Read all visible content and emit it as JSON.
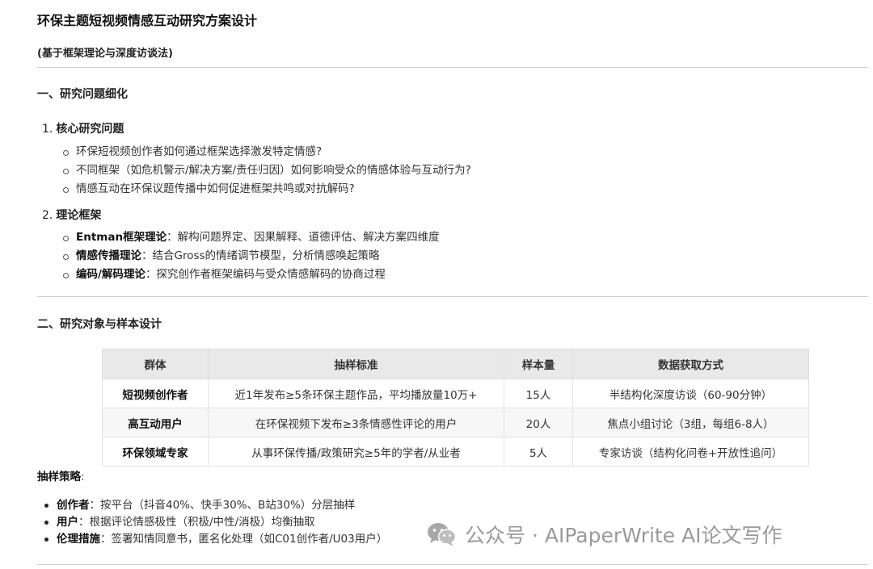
{
  "doc": {
    "title": "环保主题短视频情感互动研究方案设计",
    "subtitle": "(基于框架理论与深度访谈法)"
  },
  "section1": {
    "heading": "一、研究问题细化",
    "q_num": "1.",
    "q_title": "核心研究问题",
    "questions": [
      "环保短视频创作者如何通过框架选择激发特定情感?",
      "不同框架（如危机警示/解决方案/责任归因）如何影响受众的情感体验与互动行为?",
      "情感互动在环保议题传播中如何促进框架共鸣或对抗解码?"
    ],
    "t_num": "2.",
    "t_title": "理论框架",
    "theories": [
      {
        "term": "Entman框架理论",
        "desc": "：解构问题界定、因果解释、道德评估、解决方案四维度"
      },
      {
        "term": "情感传播理论",
        "desc": "：结合Gross的情绪调节模型，分析情感唤起策略"
      },
      {
        "term": "编码/解码理论",
        "desc": "：探究创作者框架编码与受众情感解码的协商过程"
      }
    ]
  },
  "section2": {
    "heading": "二、研究对象与样本设计",
    "table": {
      "headers": [
        "群体",
        "抽样标准",
        "样本量",
        "数据获取方式"
      ],
      "rows": [
        [
          "短视频创作者",
          "近1年发布≥5条环保主题作品，平均播放量10万+",
          "15人",
          "半结构化深度访谈（60-90分钟）"
        ],
        [
          "高互动用户",
          "在环保视频下发布≥3条情感性评论的用户",
          "20人",
          "焦点小组讨论（3组，每组6-8人）"
        ],
        [
          "环保领域专家",
          "从事环保传播/政策研究≥5年的学者/从业者",
          "5人",
          "专家访谈（结构化问卷+开放性追问）"
        ]
      ]
    },
    "strategy_label": "抽样策略",
    "strategy_colon": ":",
    "strategies": [
      {
        "term": "创作者",
        "desc": "：按平台（抖音40%、快手30%、B站30%）分层抽样"
      },
      {
        "term": "用户",
        "desc": "：根据评论情感极性（积极/中性/消极）均衡抽取"
      },
      {
        "term": "伦理措施",
        "desc": "：签署知情同意书，匿名化处理（如C01创作者/U03用户）"
      }
    ]
  },
  "watermark": {
    "icon": "wechat-icon",
    "text": "公众号 · AIPaperWrite AI论文写作"
  }
}
